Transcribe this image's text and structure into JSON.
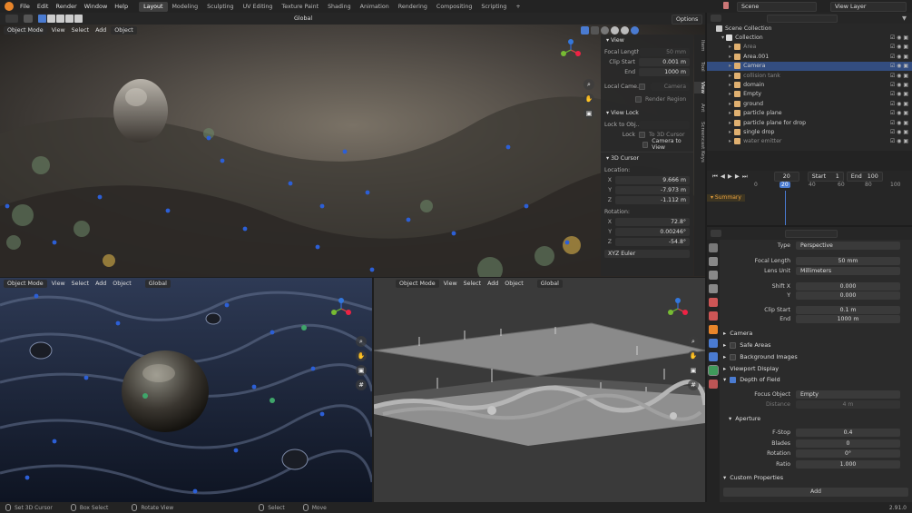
{
  "menu": [
    "File",
    "Edit",
    "Render",
    "Window",
    "Help"
  ],
  "workspaces": [
    {
      "label": "Layout",
      "active": true
    },
    {
      "label": "Modeling"
    },
    {
      "label": "Sculpting"
    },
    {
      "label": "UV Editing"
    },
    {
      "label": "Texture Paint"
    },
    {
      "label": "Shading"
    },
    {
      "label": "Animation"
    },
    {
      "label": "Rendering"
    },
    {
      "label": "Compositing"
    },
    {
      "label": "Scripting"
    }
  ],
  "scene": {
    "name": "Scene",
    "view_layer": "View Layer"
  },
  "toolbar": {
    "transform_orientation": "Global",
    "options": "Options"
  },
  "viewport_main": {
    "mode": "Object Mode",
    "menu": [
      "View",
      "Select",
      "Add",
      "Object"
    ],
    "orientation": "Global"
  },
  "viewport_bl": {
    "mode": "Object Mode",
    "menu": [
      "View",
      "Select",
      "Add",
      "Object"
    ],
    "orientation": "Global"
  },
  "viewport_br": {
    "mode": "Object Mode",
    "menu": [
      "View",
      "Select",
      "Add",
      "Object"
    ],
    "orientation": "Global"
  },
  "npanel": {
    "view_header": "View",
    "focal_length_label": "Focal Length",
    "focal_length": "50 mm",
    "clip_start_label": "Clip Start",
    "clip_start": "0.001 m",
    "end_label": "End",
    "end": "1000 m",
    "local_camera_label": "Local Came...",
    "local_camera_value": "Camera",
    "render_region": "Render Region",
    "view_lock_header": "View Lock",
    "lock_to_obj_label": "Lock to Obj...",
    "lock_label": "Lock",
    "to_3d_cursor": "To 3D Cursor",
    "camera_to_view": "Camera to View",
    "cursor_header": "3D Cursor",
    "location_label": "Location:",
    "x": "9.666 m",
    "y": "-7.973 m",
    "z": "-1.112 m",
    "rotation_label": "Rotation:",
    "rx": "72.8°",
    "ry": "0.00246°",
    "rz": "-54.8°",
    "rotation_mode": "XYZ Euler",
    "tabs": [
      "Item",
      "Tool",
      "View",
      "Ant",
      "Screencast Keys"
    ]
  },
  "outliner": {
    "root": "Scene Collection",
    "collection": "Collection",
    "items": [
      {
        "name": "Area",
        "color": "#e0b070",
        "dim": true
      },
      {
        "name": "Area.001",
        "color": "#e0b070",
        "dim": false
      },
      {
        "name": "Camera",
        "color": "#e0b070",
        "dim": false,
        "selected": true
      },
      {
        "name": "collision tank",
        "color": "#e0b070",
        "dim": true
      },
      {
        "name": "domain",
        "color": "#e0b070",
        "dim": false
      },
      {
        "name": "Empty",
        "color": "#e0b070",
        "dim": false
      },
      {
        "name": "ground",
        "color": "#e0b070",
        "dim": false
      },
      {
        "name": "particle plane",
        "color": "#e0b070",
        "dim": false
      },
      {
        "name": "particle plane for drop",
        "color": "#e0b070",
        "dim": false
      },
      {
        "name": "single drop",
        "color": "#e0b070",
        "dim": false
      },
      {
        "name": "water emitter",
        "color": "#e0b070",
        "dim": true
      }
    ]
  },
  "timeline": {
    "current_frame": "20",
    "start_label": "Start",
    "start": "1",
    "end_label": "End",
    "end": "100",
    "ticks": [
      "0",
      "20",
      "40",
      "60",
      "80",
      "100"
    ],
    "summary": "Summary"
  },
  "properties": {
    "type_label": "Type",
    "type": "Perspective",
    "focal_label": "Focal Length",
    "focal": "50 mm",
    "lens_unit_label": "Lens Unit",
    "lens_unit": "Millimeters",
    "shift_x_label": "Shift X",
    "shift_x": "0.000",
    "shift_y_label": "Y",
    "shift_y": "0.000",
    "clip_start_label": "Clip Start",
    "clip_start": "0.1 m",
    "clip_end_label": "End",
    "clip_end": "1000 m",
    "sec_camera": "Camera",
    "sec_safe": "Safe Areas",
    "sec_bg": "Background Images",
    "sec_vp_display": "Viewport Display",
    "sec_dof": "Depth of Field",
    "focus_obj_label": "Focus Object",
    "focus_obj": "Empty",
    "distance_label": "Distance",
    "distance": "4 m",
    "aperture": "Aperture",
    "fstop_label": "F-Stop",
    "fstop": "0.4",
    "blades_label": "Blades",
    "blades": "0",
    "rotation_label": "Rotation",
    "rotation": "0°",
    "ratio_label": "Ratio",
    "ratio": "1.000",
    "custom_props": "Custom Properties",
    "add": "Add"
  },
  "statusbar": {
    "set_cursor": "Set 3D Cursor",
    "box_select": "Box Select",
    "rotate_view": "Rotate View",
    "select": "Select",
    "move": "Move",
    "version": "2.91.0"
  }
}
